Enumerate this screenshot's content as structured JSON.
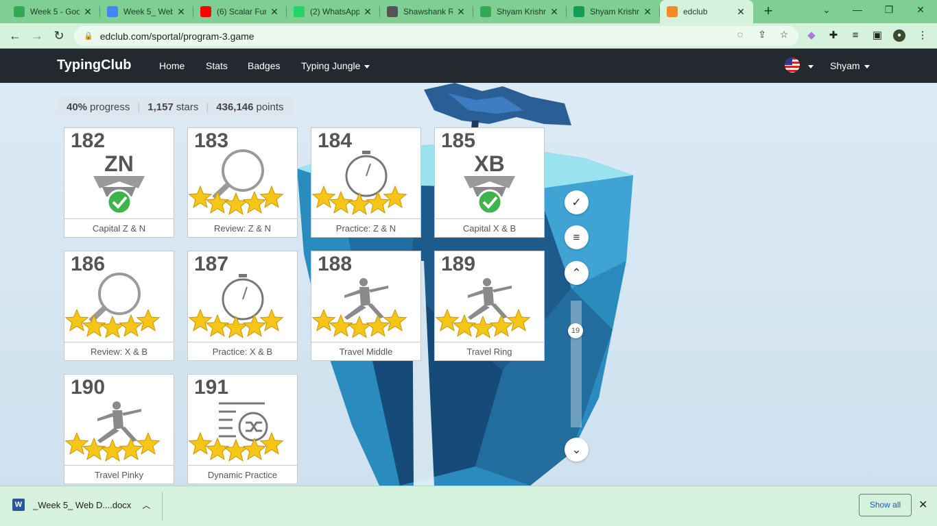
{
  "browser": {
    "tabs": [
      {
        "title": "Week 5 - Goo",
        "icon": "google-drive-icon",
        "color": "#34a853"
      },
      {
        "title": "Week 5_ Web",
        "icon": "google-docs-icon",
        "color": "#4285f4"
      },
      {
        "title": "(6) Scalar Fun",
        "icon": "youtube-icon",
        "color": "#ff0000"
      },
      {
        "title": "(2) WhatsApp",
        "icon": "whatsapp-icon",
        "color": "#25d366"
      },
      {
        "title": "Shawshank R",
        "icon": "openai-icon",
        "color": "#555555"
      },
      {
        "title": "Shyam Krishn",
        "icon": "google-drive-icon",
        "color": "#34a853"
      },
      {
        "title": "Shyam Krishn",
        "icon": "google-sheets-icon",
        "color": "#0f9d58"
      },
      {
        "title": "edclub",
        "icon": "edclub-icon",
        "color": "#f28c28"
      }
    ],
    "url": "edclub.com/sportal/program-3.game"
  },
  "site": {
    "brand": "TypingClub",
    "nav": {
      "home": "Home",
      "stats": "Stats",
      "badges": "Badges",
      "typing_jungle": "Typing Jungle"
    },
    "user": "Shyam"
  },
  "progress": {
    "percent": "40%",
    "percent_label": "progress",
    "stars": "1,157",
    "stars_label": "stars",
    "points": "436,146",
    "points_label": "points"
  },
  "lessons": [
    {
      "num": "182",
      "label": "Capital Z & N",
      "type": "badge",
      "badge_text": "ZN",
      "stars": 0
    },
    {
      "num": "183",
      "label": "Review: Z & N",
      "type": "review",
      "stars": 5
    },
    {
      "num": "184",
      "label": "Practice: Z & N",
      "type": "timer",
      "stars": 5
    },
    {
      "num": "185",
      "label": "Capital X & B",
      "type": "badge",
      "badge_text": "XB",
      "stars": 0
    },
    {
      "num": "186",
      "label": "Review: X & B",
      "type": "review",
      "stars": 5
    },
    {
      "num": "187",
      "label": "Practice: X & B",
      "type": "timer",
      "stars": 5
    },
    {
      "num": "188",
      "label": "Travel Middle",
      "type": "yoga",
      "stars": 5
    },
    {
      "num": "189",
      "label": "Travel Ring",
      "type": "yoga",
      "stars": 5
    },
    {
      "num": "190",
      "label": "Travel Pinky",
      "type": "yoga",
      "stars": 5
    },
    {
      "num": "191",
      "label": "Dynamic Practice",
      "type": "shuffle",
      "stars": 5
    }
  ],
  "side_controls": {
    "slider_value": "19"
  },
  "downloads": {
    "file": "_Week 5_ Web D....docx",
    "show_all": "Show all"
  },
  "colors": {
    "header_bg": "#24292f",
    "tabstrip_bg": "#7fcf94",
    "star": "#f5c518"
  }
}
